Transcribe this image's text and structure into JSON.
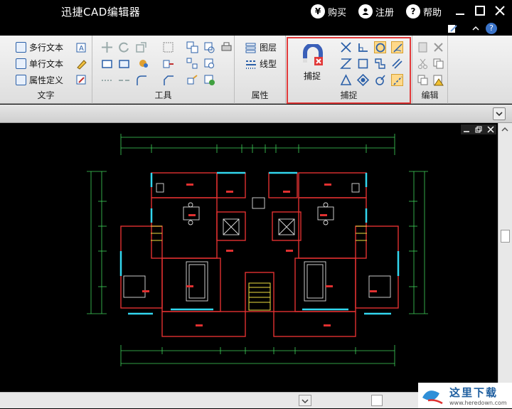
{
  "window": {
    "title": "迅捷CAD编辑器",
    "buy_label": "购买",
    "register_label": "注册",
    "help_label": "帮助"
  },
  "ribbon": {
    "text_group": {
      "label": "文字",
      "items": [
        "多行文本",
        "单行文本",
        "属性定义"
      ]
    },
    "tools_group": {
      "label": "工具"
    },
    "properties_group": {
      "label": "属性",
      "items": [
        "图层",
        "线型"
      ]
    },
    "snap_group": {
      "label": "捕捉",
      "button_label": "捕捉"
    },
    "edit_group": {
      "label": "编辑"
    }
  },
  "colors": {
    "accent": "#e23a3a",
    "titlebar": "#000000",
    "ribbon_bg": "#e9e9e9",
    "drawing_bg": "#000000"
  },
  "watermark": {
    "text": "这里下载",
    "url": "www.heredown.com"
  }
}
